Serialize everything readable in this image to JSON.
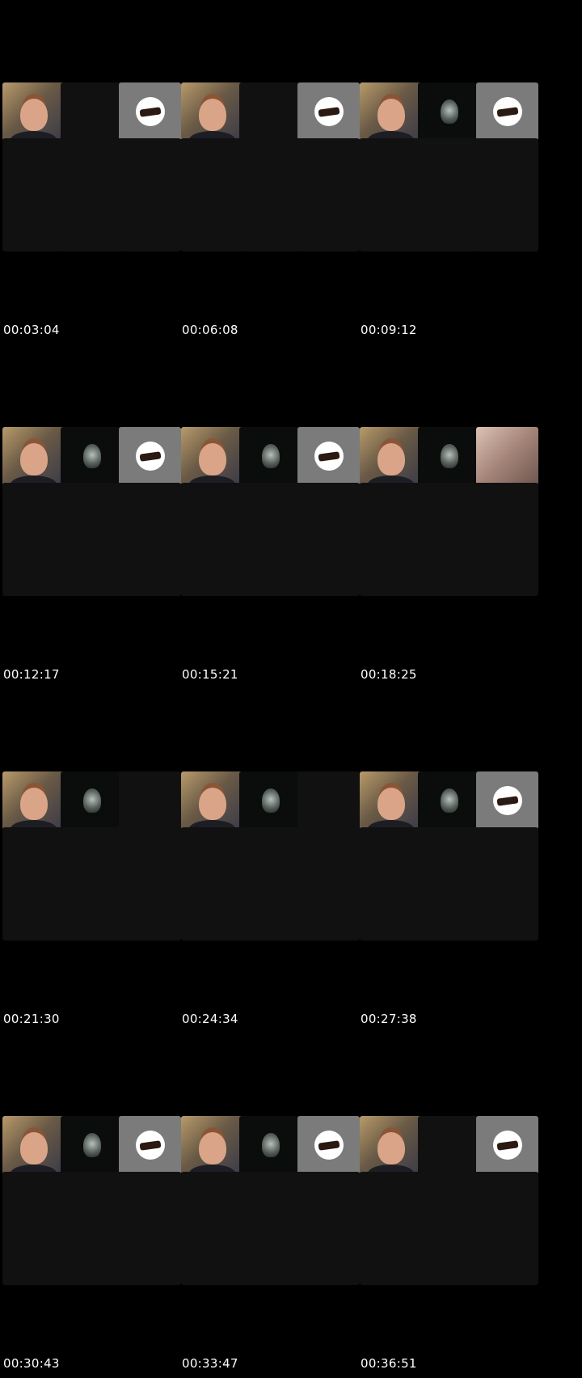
{
  "contact_sheet": {
    "thumbnails": [
      {
        "timestamp": "00:03:04",
        "tiles": [
          "face",
          "empty",
          "logo",
          "empty",
          "empty",
          "empty",
          "empty",
          "empty",
          "empty"
        ]
      },
      {
        "timestamp": "00:06:08",
        "tiles": [
          "face",
          "empty",
          "logo",
          "empty",
          "empty",
          "empty",
          "empty",
          "empty",
          "empty"
        ]
      },
      {
        "timestamp": "00:09:12",
        "tiles": [
          "face",
          "mask",
          "logo",
          "empty",
          "empty",
          "empty",
          "empty",
          "empty",
          "empty"
        ]
      },
      {
        "timestamp": "00:12:17",
        "tiles": [
          "face",
          "mask",
          "logo",
          "empty",
          "empty",
          "empty",
          "empty",
          "empty",
          "empty"
        ]
      },
      {
        "timestamp": "00:15:21",
        "tiles": [
          "face",
          "mask",
          "logo",
          "empty",
          "empty",
          "empty",
          "empty",
          "empty",
          "empty"
        ]
      },
      {
        "timestamp": "00:18:25",
        "tiles": [
          "face",
          "mask",
          "face2",
          "empty",
          "empty",
          "empty",
          "empty",
          "empty",
          "empty"
        ]
      },
      {
        "timestamp": "00:21:30",
        "tiles": [
          "face",
          "mask",
          "empty",
          "empty",
          "empty",
          "empty",
          "empty",
          "empty",
          "empty"
        ]
      },
      {
        "timestamp": "00:24:34",
        "tiles": [
          "face",
          "mask",
          "empty",
          "empty",
          "empty",
          "empty",
          "empty",
          "empty",
          "empty"
        ]
      },
      {
        "timestamp": "00:27:38",
        "tiles": [
          "face",
          "mask",
          "logo",
          "empty",
          "empty",
          "empty",
          "empty",
          "empty",
          "empty"
        ]
      },
      {
        "timestamp": "00:30:43",
        "tiles": [
          "face",
          "mask",
          "logo",
          "empty",
          "empty",
          "empty",
          "empty",
          "empty",
          "empty"
        ]
      },
      {
        "timestamp": "00:33:47",
        "tiles": [
          "face",
          "mask",
          "logo",
          "empty",
          "empty",
          "empty",
          "empty",
          "empty",
          "empty"
        ]
      },
      {
        "timestamp": "00:36:51",
        "tiles": [
          "face",
          "empty",
          "logo",
          "empty",
          "empty",
          "empty",
          "empty",
          "empty",
          "empty"
        ]
      }
    ]
  }
}
